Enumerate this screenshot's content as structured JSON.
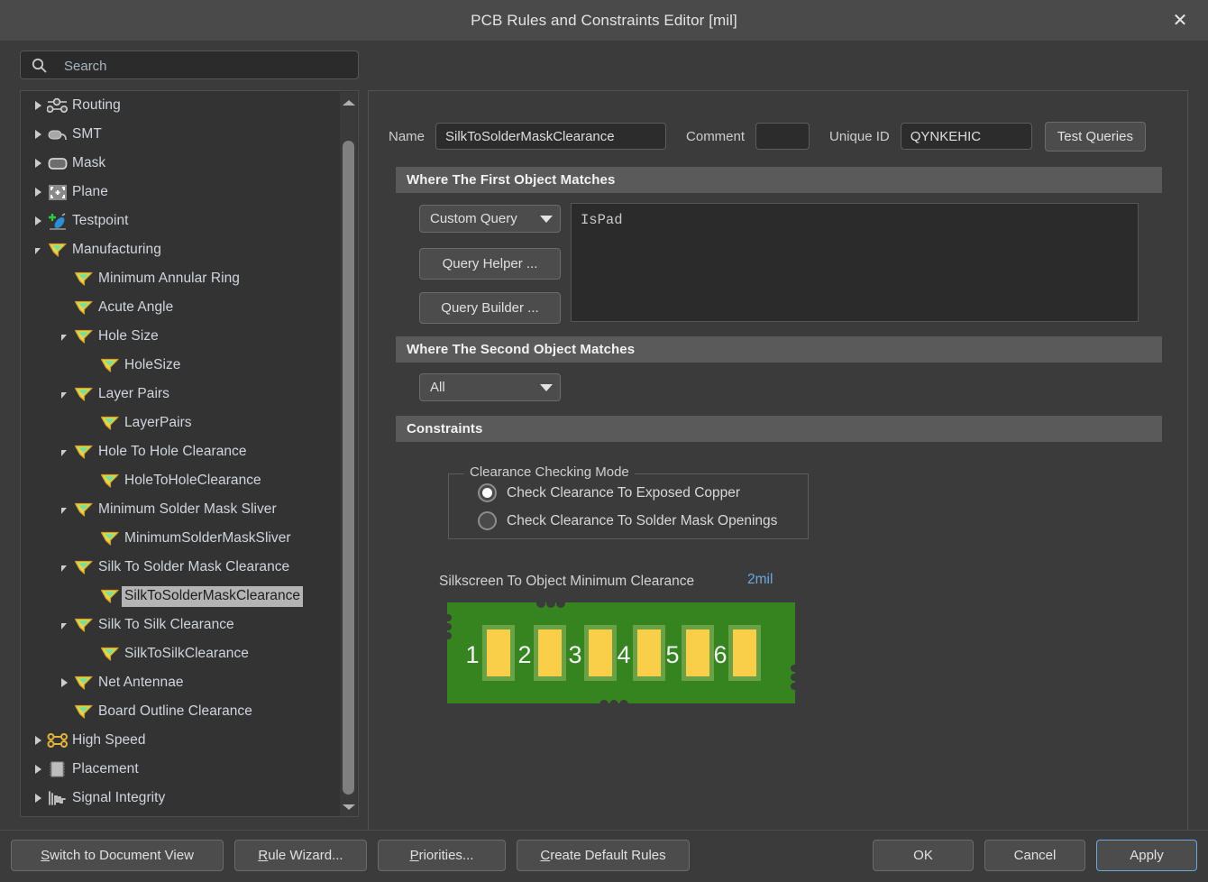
{
  "window": {
    "title": "PCB Rules and Constraints Editor [mil]",
    "close_icon": "close-icon",
    "close_label": "✕"
  },
  "sidebar": {
    "search": {
      "placeholder": "Search",
      "value": "",
      "icon": "search-icon"
    },
    "tree": [
      {
        "label": "Routing",
        "indent": 0,
        "expander": "collapsed",
        "icon": "routing-icon",
        "selected": false
      },
      {
        "label": "SMT",
        "indent": 0,
        "expander": "collapsed",
        "icon": "smt-icon",
        "selected": false
      },
      {
        "label": "Mask",
        "indent": 0,
        "expander": "collapsed",
        "icon": "mask-icon",
        "selected": false
      },
      {
        "label": "Plane",
        "indent": 0,
        "expander": "collapsed",
        "icon": "plane-icon",
        "selected": false
      },
      {
        "label": "Testpoint",
        "indent": 0,
        "expander": "collapsed",
        "icon": "testpoint-icon",
        "selected": false
      },
      {
        "label": "Manufacturing",
        "indent": 0,
        "expander": "expanded",
        "icon": "manufacturing-icon",
        "selected": false
      },
      {
        "label": "Minimum Annular Ring",
        "indent": 1,
        "expander": "none",
        "icon": "manufacturing-icon",
        "selected": false
      },
      {
        "label": "Acute Angle",
        "indent": 1,
        "expander": "none",
        "icon": "manufacturing-icon",
        "selected": false
      },
      {
        "label": "Hole Size",
        "indent": 1,
        "expander": "expanded",
        "icon": "manufacturing-icon",
        "selected": false
      },
      {
        "label": "HoleSize",
        "indent": 2,
        "expander": "none",
        "icon": "manufacturing-icon",
        "selected": false
      },
      {
        "label": "Layer Pairs",
        "indent": 1,
        "expander": "expanded",
        "icon": "manufacturing-icon",
        "selected": false
      },
      {
        "label": "LayerPairs",
        "indent": 2,
        "expander": "none",
        "icon": "manufacturing-icon",
        "selected": false
      },
      {
        "label": "Hole To Hole Clearance",
        "indent": 1,
        "expander": "expanded",
        "icon": "manufacturing-icon",
        "selected": false
      },
      {
        "label": "HoleToHoleClearance",
        "indent": 2,
        "expander": "none",
        "icon": "manufacturing-icon",
        "selected": false
      },
      {
        "label": "Minimum Solder Mask Sliver",
        "indent": 1,
        "expander": "expanded",
        "icon": "manufacturing-icon",
        "selected": false
      },
      {
        "label": "MinimumSolderMaskSliver",
        "indent": 2,
        "expander": "none",
        "icon": "manufacturing-icon",
        "selected": false
      },
      {
        "label": "Silk To Solder Mask Clearance",
        "indent": 1,
        "expander": "expanded",
        "icon": "manufacturing-icon",
        "selected": false
      },
      {
        "label": "SilkToSolderMaskClearance",
        "indent": 2,
        "expander": "none",
        "icon": "manufacturing-icon",
        "selected": true
      },
      {
        "label": "Silk To Silk Clearance",
        "indent": 1,
        "expander": "expanded",
        "icon": "manufacturing-icon",
        "selected": false
      },
      {
        "label": "SilkToSilkClearance",
        "indent": 2,
        "expander": "none",
        "icon": "manufacturing-icon",
        "selected": false
      },
      {
        "label": "Net Antennae",
        "indent": 1,
        "expander": "collapsed",
        "icon": "manufacturing-icon",
        "selected": false
      },
      {
        "label": "Board Outline Clearance",
        "indent": 1,
        "expander": "none",
        "icon": "manufacturing-icon",
        "selected": false
      },
      {
        "label": "High Speed",
        "indent": 0,
        "expander": "collapsed",
        "icon": "highspeed-icon",
        "selected": false
      },
      {
        "label": "Placement",
        "indent": 0,
        "expander": "collapsed",
        "icon": "placement-icon",
        "selected": false
      },
      {
        "label": "Signal Integrity",
        "indent": 0,
        "expander": "collapsed",
        "icon": "signal-icon",
        "selected": false
      }
    ]
  },
  "rule": {
    "name_label": "Name",
    "name_value": "SilkToSolderMaskClearance",
    "comment_label": "Comment",
    "comment_value": "",
    "unique_id_label": "Unique ID",
    "unique_id_value": "QYNKEHIC",
    "test_queries_label": "Test Queries"
  },
  "first_object": {
    "header": "Where The First Object Matches",
    "scope_value": "Custom Query",
    "query_helper_label": "Query Helper ...",
    "query_builder_label": "Query Builder ...",
    "query_text": "IsPad"
  },
  "second_object": {
    "header": "Where The Second Object Matches",
    "scope_value": "All"
  },
  "constraints": {
    "header": "Constraints",
    "checking_mode": {
      "legend": "Clearance Checking Mode",
      "options": [
        {
          "label": "Check Clearance To Exposed Copper",
          "checked": true
        },
        {
          "label": "Check Clearance To Solder Mask Openings",
          "checked": false
        }
      ]
    },
    "clearance_label": "Silkscreen To Object Minimum Clearance",
    "clearance_value": "2mil",
    "clearance_value_color": "#6fa8dc",
    "pcb_preview": {
      "board_color": "#35841f",
      "pad_color": "#f9cf4a",
      "pad_ring_color": "#6aa046",
      "pad_labels": [
        "1",
        "2",
        "3",
        "4",
        "5",
        "6"
      ]
    }
  },
  "footer": {
    "switch_doc_label": "Switch to Document View",
    "switch_doc_accel": "S",
    "rule_wizard_label": "Rule Wizard...",
    "rule_wizard_accel": "R",
    "priorities_label": "Priorities...",
    "priorities_accel": "P",
    "create_default_label": "Create Default Rules",
    "create_default_accel": "C",
    "ok_label": "OK",
    "cancel_label": "Cancel",
    "apply_label": "Apply",
    "apply_focus_color": "#6aa6e0"
  }
}
